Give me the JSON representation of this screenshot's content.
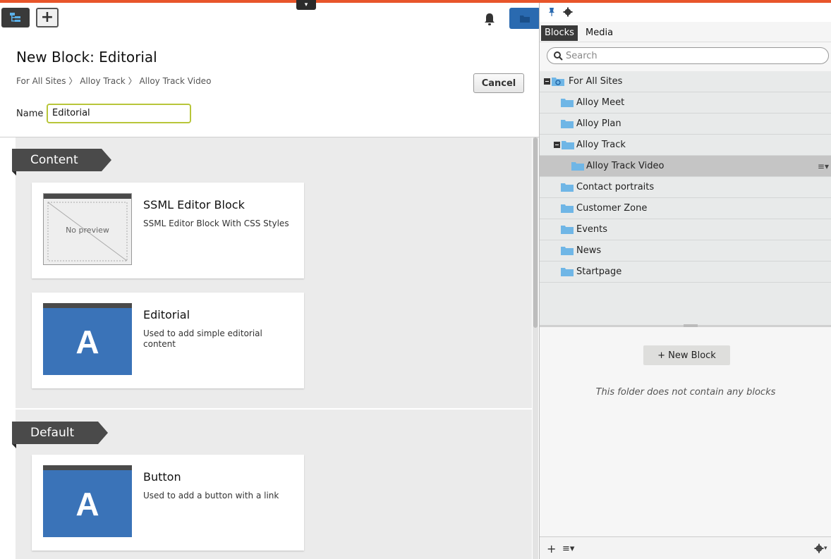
{
  "toolbar": {
    "drop_arrow": "▾"
  },
  "page": {
    "title": "New Block: Editorial",
    "breadcrumb": [
      "For All Sites",
      "Alloy Track",
      "Alloy Track Video"
    ],
    "breadcrumb_separator": "〉",
    "cancel_label": "Cancel",
    "name_label": "Name",
    "name_value": "Editorial"
  },
  "sections": [
    {
      "title": "Content",
      "cards": [
        {
          "title": "SSML Editor Block",
          "description": "SSML Editor Block With CSS Styles",
          "thumb_text": "No preview"
        },
        {
          "title": "Editorial",
          "description": "Used to add simple editorial content",
          "thumb_letter": "A"
        }
      ]
    },
    {
      "title": "Default",
      "cards": [
        {
          "title": "Button",
          "description": "Used to add a button with a link",
          "thumb_letter": "A"
        }
      ]
    }
  ],
  "right_pane": {
    "tabs": [
      "Blocks",
      "Media"
    ],
    "search_placeholder": "Search",
    "tree": [
      {
        "label": "For All Sites",
        "level": 0,
        "expanded": true,
        "type": "site"
      },
      {
        "label": "Alloy Meet",
        "level": 1
      },
      {
        "label": "Alloy Plan",
        "level": 1
      },
      {
        "label": "Alloy Track",
        "level": 1,
        "expanded": true
      },
      {
        "label": "Alloy Track Video",
        "level": 2,
        "selected": true
      },
      {
        "label": "Contact portraits",
        "level": 1
      },
      {
        "label": "Customer Zone",
        "level": 1
      },
      {
        "label": "Events",
        "level": 1
      },
      {
        "label": "News",
        "level": 1
      },
      {
        "label": "Startpage",
        "level": 1
      }
    ],
    "new_block_label": "+ New Block",
    "empty_message": "This folder does not contain any blocks"
  },
  "colors": {
    "accent": "#e8552a",
    "folder": "#6fb6e6",
    "block_thumb": "#3a73b8",
    "name_focus": "#b8c63a"
  }
}
